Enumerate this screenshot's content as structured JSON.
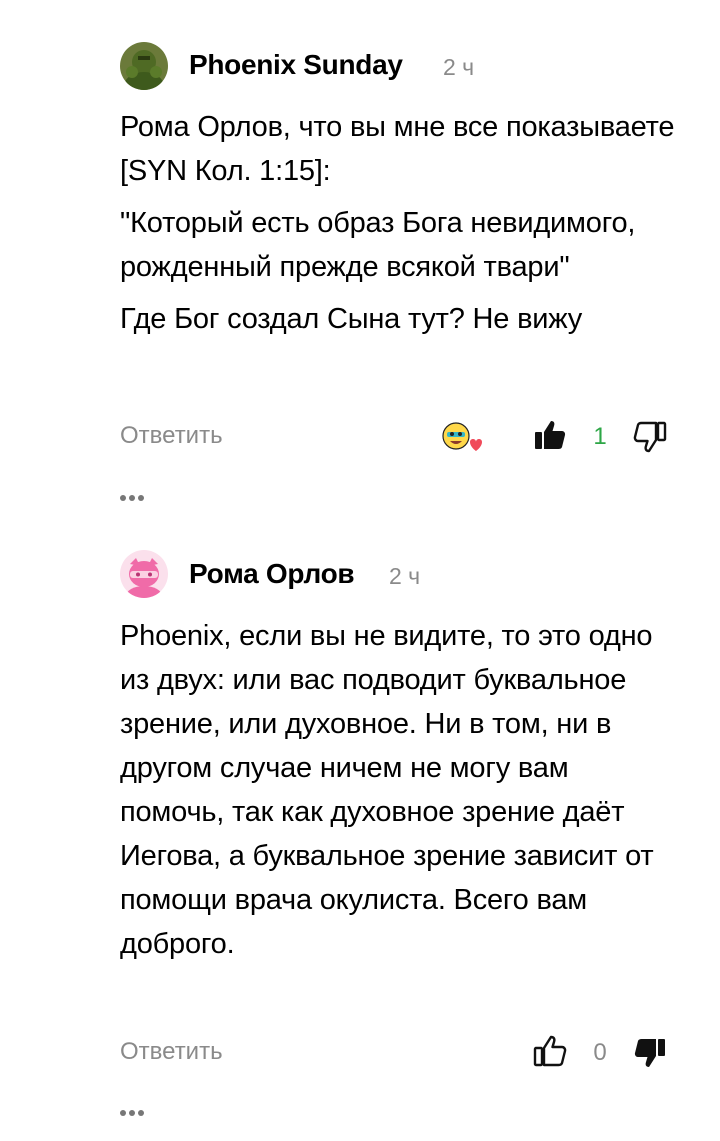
{
  "comments": [
    {
      "author": "Phoenix Sunday",
      "time": "2 ч",
      "paragraphs": [
        "Рома Орлов, что вы мне все показываете [SYN Кол. 1:15]:",
        "\"Который есть образ Бога невидимого, рожденный прежде всякой твари\"",
        "Где Бог создал Сына тут? Не вижу"
      ],
      "reply_label": "Ответить",
      "likes": "1",
      "liked": true,
      "has_reaction": true,
      "like_color": "#2da646",
      "more_icon": "ellipsis-icon"
    },
    {
      "author": "Рома Орлов",
      "time": "2 ч",
      "paragraphs": [
        "Phoenix, если вы не видите, то это одно из двух: или вас подводит буквальное зрение, или духовное. Ни в том, ни в другом случае ничем не могу вам помочь, так как духовное зрение даёт Иегова, а буквальное зрение зависит от помощи врача окулиста. Всего вам доброго."
      ],
      "reply_label": "Ответить",
      "likes": "0",
      "liked": false,
      "disliked": true,
      "more_icon": "ellipsis-icon"
    }
  ]
}
